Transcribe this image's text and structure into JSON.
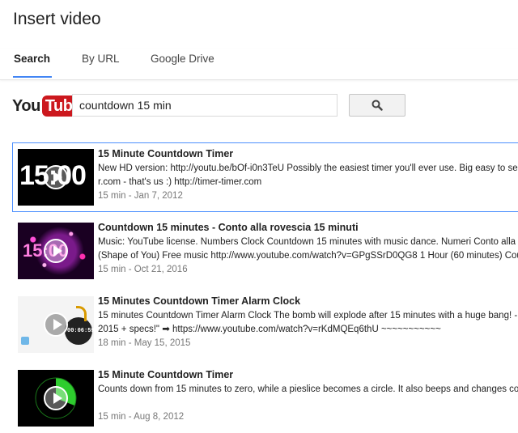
{
  "dialog": {
    "title": "Insert video"
  },
  "tabs": [
    {
      "label": "Search",
      "active": true
    },
    {
      "label": "By URL",
      "active": false
    },
    {
      "label": "Google Drive",
      "active": false
    }
  ],
  "youtube_logo": {
    "you": "You",
    "tube": "Tube"
  },
  "search": {
    "value": "countdown 15 min",
    "button_icon": "magnifier-icon"
  },
  "accent_color": "#4285f4",
  "selection_border_color": "#4d90fe",
  "results": [
    {
      "title": "15 Minute Countdown Timer",
      "desc_line1": "New HD version: http://youtu.be/bOf-i0n3TeU Possibly the easiest timer you'll ever use. Big easy to see",
      "desc_line2": "r.com - that's us :) http://timer-timer.com",
      "meta": "15 min - Jan 7, 2012",
      "thumb_text": "15:00",
      "selected": true
    },
    {
      "title": "Countdown 15 minutes - Conto alla rovescia 15 minuti",
      "desc_line1": "Music: YouTube license. Numbers Clock Countdown 15 minutes with music dance. Numeri Conto alla",
      "desc_line2": "(Shape of You) Free music http://www.youtube.com/watch?v=GPgSSrD0QG8 1 Hour (60 minutes) Cou",
      "meta": "15 min - Oct 21, 2016",
      "thumb_text": "15:00",
      "selected": false
    },
    {
      "title": "15 Minutes Countdown Timer Alarm Clock",
      "desc_line1": "15 minutes Countdown Timer Alarm Clock The bomb will explode after 15 minutes with a huge bang! -",
      "desc_line2": "2015 + specs!\" ➡ https://www.youtube.com/watch?v=rKdMQEq6thU ~~~~~~~~~~~",
      "meta": "18 min - May 15, 2015",
      "thumb_text": "00:06:59",
      "selected": false
    },
    {
      "title": "15 Minute Countdown Timer",
      "desc_line1": "Counts down from 15 minutes to zero, while a pieslice becomes a circle. It also beeps and changes co",
      "desc_line2": "",
      "meta": "15 min - Aug 8, 2012",
      "selected": false
    }
  ]
}
